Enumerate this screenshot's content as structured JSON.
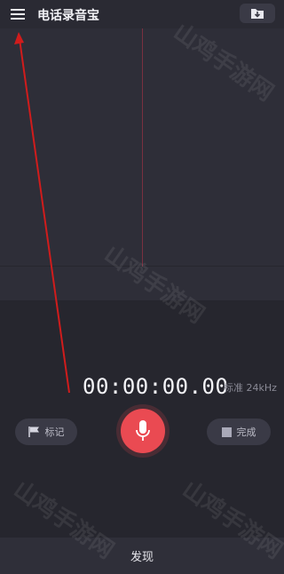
{
  "header": {
    "title": "电话录音宝",
    "menu_icon": "hamburger-menu-icon",
    "folder_icon": "folder-download-icon"
  },
  "recorder": {
    "timer": "00:00:00.00",
    "quality": "标准 24kHz",
    "mark_label": "标记",
    "done_label": "完成",
    "mic_icon": "microphone-icon"
  },
  "bottom": {
    "label": "发现"
  },
  "watermark": {
    "text": "山鸡手游网"
  },
  "colors": {
    "background": "#26262e",
    "accent": "#ea4a52",
    "annotation_arrow": "#d01c1c"
  }
}
